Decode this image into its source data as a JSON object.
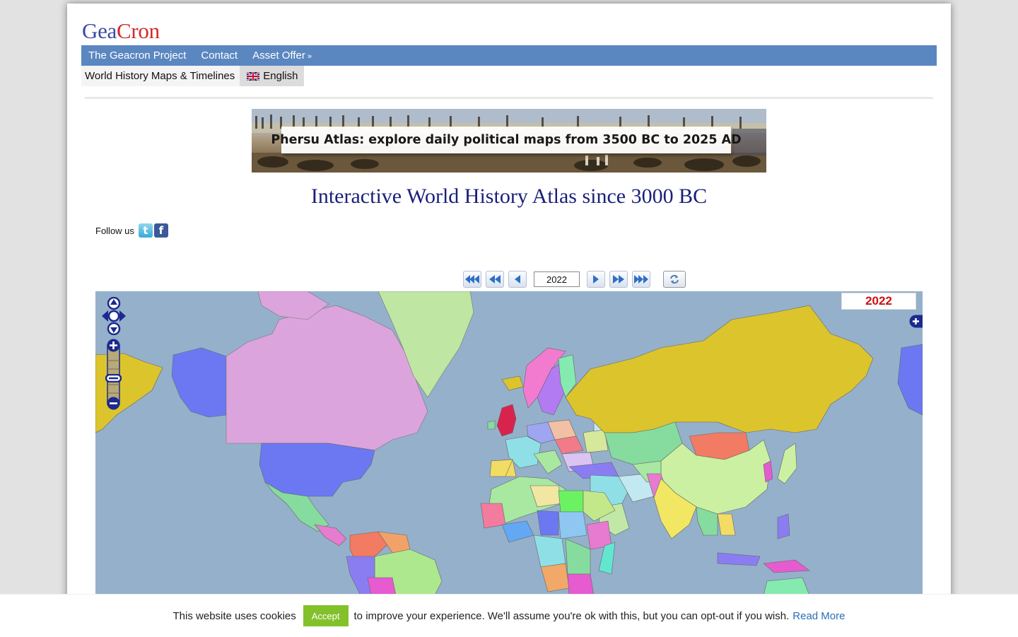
{
  "logo": {
    "part1": "Gea",
    "part2": "Cron"
  },
  "topnav": {
    "items": [
      {
        "label": "The Geacron Project"
      },
      {
        "label": "Contact"
      },
      {
        "label": "Asset Offer"
      }
    ],
    "dropdown_icon": "double-chevron-down-icon"
  },
  "subnav": {
    "home_label": "World History Maps & Timelines",
    "language": "English",
    "language_flag": "uk-flag-icon"
  },
  "banner": {
    "text": "Phersu Atlas: explore daily political maps from 3500 BC to 2025 AD"
  },
  "title": "Interactive World History Atlas since 3000 BC",
  "follow": {
    "label": "Follow us",
    "icons": [
      "twitter-icon",
      "facebook-icon"
    ]
  },
  "timeline": {
    "year": "2022",
    "buttons": [
      "fast-rewind-icon",
      "rewind-icon",
      "step-back-icon",
      "step-forward-icon",
      "forward-icon",
      "fast-forward-icon",
      "refresh-icon"
    ]
  },
  "map": {
    "year_label": "2022",
    "colors": {
      "ocean": "#95b0cb",
      "russia": "#dcc42c",
      "usa": "#6b78f2",
      "canada": "#dca4dc",
      "greenland": "#bfe6a2",
      "china": "#cbf0a2",
      "mongolia": "#f27b63"
    }
  },
  "cookie": {
    "text_before": "This website uses cookies",
    "accept_label": "Accept",
    "text_after": "to improve your experience. We'll assume you're ok with this, but you can opt-out if you wish.",
    "read_more": "Read More"
  }
}
